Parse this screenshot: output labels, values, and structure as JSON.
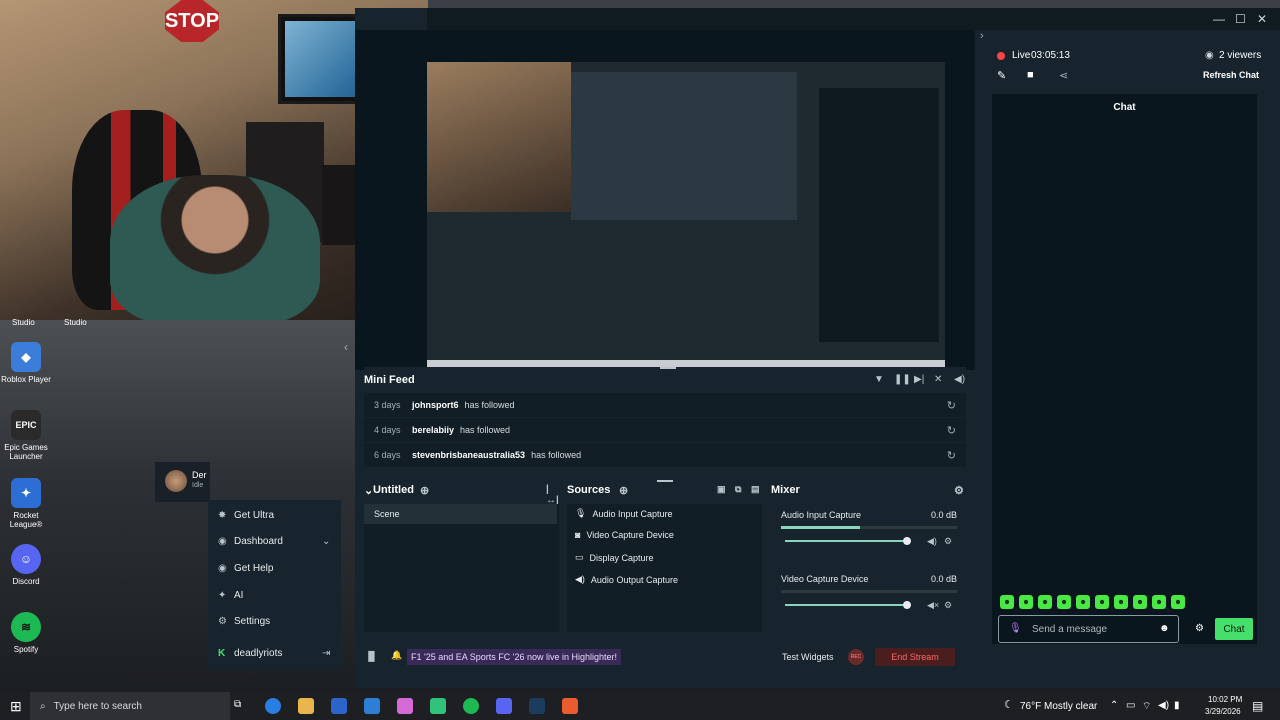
{
  "desktop": {
    "icons": [
      {
        "label": "Roblox Player",
        "icon": "roblox-icon",
        "color": "#3b7dd8"
      },
      {
        "label": "Epic Games Launcher",
        "icon": "epic-games-icon",
        "color": "#2a2a2a"
      },
      {
        "label": "Rocket League®",
        "icon": "rocket-league-icon",
        "color": "#2c6ed3"
      },
      {
        "label": "Discord",
        "icon": "discord-icon",
        "color": "#5865f2"
      },
      {
        "label": "Spotify",
        "icon": "spotify-icon",
        "color": "#1db954"
      }
    ],
    "studio_labels": [
      "Studio",
      "Studio"
    ]
  },
  "webcam": {
    "stop_sign": "STOP"
  },
  "sidebar": {
    "user_name": "Der",
    "user_status": "Idle",
    "items": [
      {
        "label": "Get Ultra",
        "icon": "ultra-icon"
      },
      {
        "label": "Dashboard",
        "icon": "dashboard-icon"
      },
      {
        "label": "Get Help",
        "icon": "help-icon"
      },
      {
        "label": "AI",
        "icon": "ai-icon"
      },
      {
        "label": "Settings",
        "icon": "settings-icon"
      }
    ],
    "account": "deadlyriots"
  },
  "minifeed": {
    "title": "Mini Feed",
    "rows": [
      {
        "time": "3 days",
        "user": "johnsport6",
        "action": "has followed"
      },
      {
        "time": "4 days",
        "user": "berelabiiy",
        "action": "has followed"
      },
      {
        "time": "6 days",
        "user": "stevenbrisbaneaustralia53",
        "action": "has followed"
      }
    ]
  },
  "scenes": {
    "title": "Untitled",
    "items": [
      "Scene"
    ]
  },
  "sources": {
    "title": "Sources",
    "items": [
      {
        "label": "Audio Input Capture",
        "icon": "microphone-icon"
      },
      {
        "label": "Video Capture Device",
        "icon": "camera-icon"
      },
      {
        "label": "Display Capture",
        "icon": "monitor-icon"
      },
      {
        "label": "Audio Output Capture",
        "icon": "speaker-icon"
      }
    ]
  },
  "mixer": {
    "title": "Mixer",
    "channels": [
      {
        "name": "Audio Input Capture",
        "level": "0.0 dB",
        "volume": 0.98,
        "meter": 0.45
      },
      {
        "name": "Video Capture Device",
        "level": "0.0 dB",
        "volume": 0.98,
        "meter": 0.0
      }
    ]
  },
  "footer": {
    "promo": "F1 '25 and EA Sports FC '26 now live in Highlighter!",
    "test_widgets": "Test Widgets",
    "rec": "REC",
    "end_stream": "End Stream"
  },
  "chat": {
    "live_label": "Live",
    "live_time": "03:05:13",
    "viewers": "2 viewers",
    "refresh": "Refresh Chat",
    "title": "Chat",
    "placeholder": "Send a message",
    "send": "Chat",
    "emote_count": 10
  },
  "taskbar": {
    "search_placeholder": "Type here to search",
    "weather_temp": "76°F",
    "weather_desc": "Mostly clear",
    "time": "10:02 PM",
    "date": "3/29/2026"
  },
  "colors": {
    "accent_green": "#45e06b",
    "live_red": "#ff4444",
    "panel_bg": "#17242d",
    "list_bg": "#111e26"
  }
}
